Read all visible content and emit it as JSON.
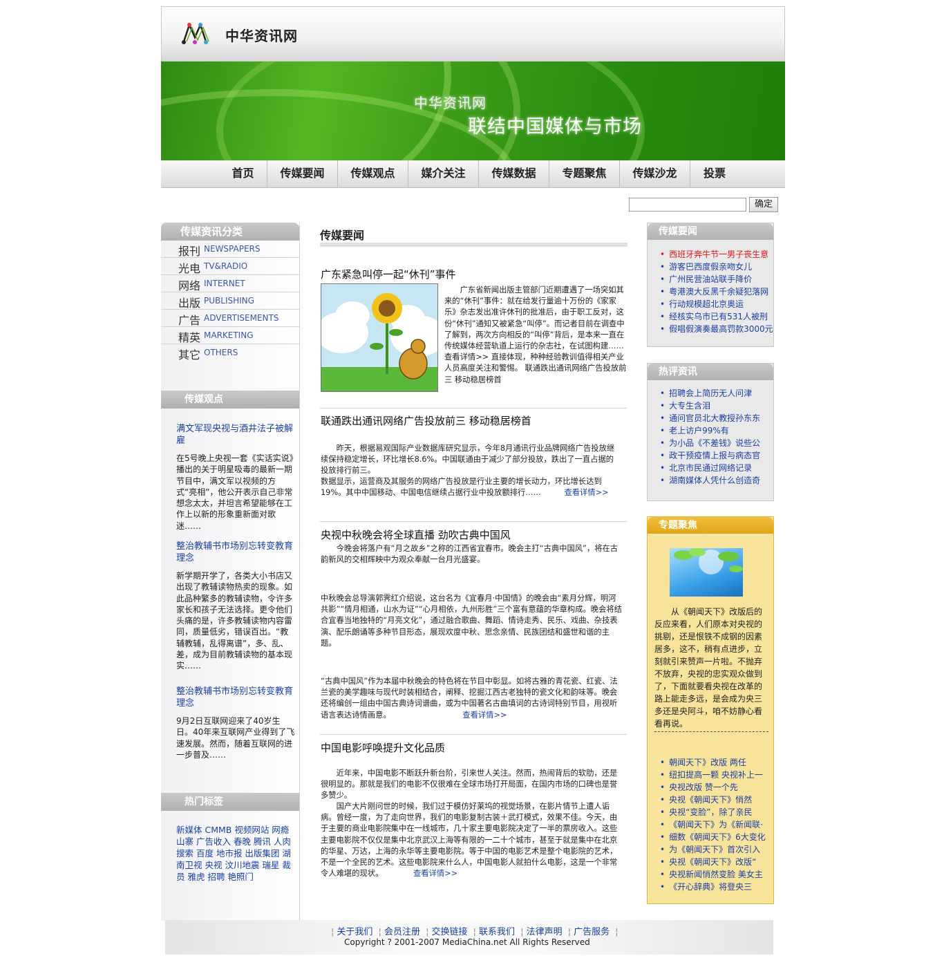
{
  "site": {
    "name": "中华资讯网"
  },
  "banner": {
    "line1": "中华资讯网",
    "line2": "联结中国媒体与市场"
  },
  "nav": [
    "首页",
    "传媒要闻",
    "传媒观点",
    "媒介关注",
    "传媒数据",
    "专题聚焦",
    "传媒沙龙",
    "投票"
  ],
  "search": {
    "button": "确定",
    "value": ""
  },
  "left": {
    "cat_head": "传媒资讯分类",
    "categories": [
      {
        "cn": "报刊",
        "en": "NEWSPAPERS"
      },
      {
        "cn": "光电",
        "en": "TV&RADIO"
      },
      {
        "cn": "网络",
        "en": "INTERNET"
      },
      {
        "cn": "出版",
        "en": "PUBLISHING"
      },
      {
        "cn": "广告",
        "en": "ADVERTISEMENTS"
      },
      {
        "cn": "精英",
        "en": "MARKETING"
      },
      {
        "cn": "其它",
        "en": "OTHERS"
      }
    ],
    "views_head": "传媒观点",
    "views": [
      {
        "title": "满文军现央视与酒井法子被解雇",
        "text": "在5号晚上央视一套《实话实说》播出的关于明星吸毒的最新一期节目中，满文军以视频的方式“亮相”，他公开表示自己非常想念太太，并坦言希望能够在工作上以新的形象重新面对歌迷……"
      },
      {
        "title": "整治教辅书市场别忘转变教育理念",
        "text": "新学期开学了，各类大小书店又出现了教辅读物热卖的现象。如此品种繁多的教辅读物，令许多家长和孩子无法选择。更令他们头痛的是，许多教辅读物内容雷同，质量低劣，错误百出。“教辅教辅，乱得离谱”，多、乱、差，成为目前教辅读物的基本现实……"
      },
      {
        "title": "整治教辅书市场别忘转变教育理念",
        "text": "9月2日互联网迎来了40岁生日。40年来互联网产业得到了飞速发展。然而，随着互联网的进一步普及……"
      }
    ],
    "tags_head": "热门标签",
    "tags": "新媒体 CMMB 视频网站 网瘾 山寨 广告收入 春晚 腾讯 人肉搜索 百度 地市报 出版集团 湖南卫视 央视 汶川地震 瑞星 裁员 雅虎 招聘 艳照门"
  },
  "center": {
    "head": "传媒要闻",
    "articles": [
      {
        "title": "广东紧急叫停一起“休刊”事件",
        "text": "　　广东省新闻出版主管部门近期遭遇了一场突如其来的“休刊”事件：就在给发行量逾十万份的《家家乐》杂志发出准许休刊的批准后，由于职工反对，这份“休刊”通知又被紧急“叫停”。而记者目前在调查中了解到，两次方向相反的“叫停”背后，是本来一直在传统媒体经营轨道上运行的杂志社，在试图构建…… 查看详情>> 直接体现，种种经验教训值得相关产业人员高度关注和警惕。 联通跌出通讯网络广告投放前三 移动稳居榜首"
      },
      {
        "title": "联通跌出通讯网络广告投放前三 移动稳居榜首",
        "text": "　　昨天，根据易观国际产业数据库研究显示，今年8月通讯行业品牌网络广告投放继续保持稳定增长，环比增长8.6%。中国联通由于减少了部分投放，跌出了一直占据的投放排行前三。",
        "text2": "数据显示，运营商及其服务的网络广告投放是行业主要的增长动力，环比增长达到19%。其中中国移动、中国电信继续占据行业中投放额排行……",
        "more": "查看详情>>"
      },
      {
        "title": "央视中秋晚会将全球直播 劲吹古典中国风",
        "p1": "　　今晚会将落户有“月之故乡”之称的江西省宜春市。晚会主打“古典中国风”，将在古韵新风的交相辉映中为观众奉献一台月光盛宴。",
        "p2": "中秋晚会总导演郭霁红介绍说，这台名为《宜春月·中国情》的晚会由“素月分辉，明河共影”“情月相通，山水为证”“心月相依，九州形胜”三个富有意蕴的华章构成。晚会将结合宜春当地独特的“月亮文化”，通过融合歌曲、舞蹈、情诗走秀、民乐、戏曲、杂技表演、配乐朗诵等多种节目形态，展现欢度中秋、思念亲情、民族团结和盛世和谐的主题。",
        "p3": "“古典中国风”作为本届中秋晚会的特色将在节目中彰显。如将古雅的青花瓷、红瓷、法兰瓷的美学趣味与现代时装相结合，阐释、挖掘江西古老独特的瓷文化和韵味等。晚会还将编创一组由中国古典诗词谱曲，或为中国著名古曲填词的古诗词特别节目，用视听语言表达诗情画意。",
        "more": "查看详情>>"
      },
      {
        "title": "中国电影呼唤提升文化品质",
        "p1": "　　近年来，中国电影不断跃升新台阶，引来世人关注。然而，热闹背后的软肋，还是很明显的。那就是我们的电影不仅很难在全球市场打开局面，在国内市场的口碑也是誉多赞少。",
        "p2": "　　国产大片刚问世的时候，我们过于模仿好莱坞的视觉场景，在影片情节上遭人诟病。曾经一度，为了走向世界，我们的电影复制古装＋武打模式，效果不佳。今天，由于主要的商业电影院集中在一线城市，几十家主要电影院决定了一半的票房收入。这些主要电影院不仅仅是集中北京武汉上海等有限的一二十个城市，甚至于就是集中在北京的华星、万达，上海的永华等主要电影院。等于中国的电影艺术是整个电影院的艺术，不是一个全民的艺术。这些电影院来什么人，中国电影人就拍什么电影，这是一个非常令人难堪的现状。",
        "more": "查看详情>>"
      }
    ]
  },
  "right": {
    "news_head": "传媒要闻",
    "news": [
      "西班牙奔牛节一男子丧生意",
      "游客巴西度假亲吻女儿",
      "广州民营油站联手降价",
      "粤港澳大反黑千余疑犯落网",
      "行动规模超北京奥运",
      "经核实乌市已有531人被刑",
      "假唱假演奏最高罚款3000元"
    ],
    "hot_head": "热评资讯",
    "hot": [
      "招聘会上简历无人问津",
      "大专生含泪",
      "通问官员北大教授孙东东",
      "老上访户99%有",
      "为小品《不差钱》说些公",
      "政干预疫情上报与病态官",
      "北京市民通过网络记录",
      "湖南媒体人凭什么创造奇"
    ],
    "special_head": "专题聚焦",
    "special_text": "　　从《朝闻天下》改版后的反应来看，人们原本对央视的挑剔，还是恨铁不成钢的因素居多，这不，稍有点进步，立刻就引来赞声一片啦。不抛弃不放弃，央视的忠实观众做到了，下面就要看央视在改革的路上能走多远，是会成为央三多还是央阿斗，咱不妨静心看看再说。",
    "special_list": [
      "朝闻天下》改版 两任",
      "纽扣提高一颗 央视补上一",
      "央视改版 赞一个先",
      "央视《朝闻天下》悄然",
      "央视“变脸”，除了亲民",
      "《朝闻天下》为《新闻联·",
      "细数《朝闻天下》6大变化",
      "为《朝闻天下》首次引入",
      "央视《朝闻天下》改版“",
      "央视新闻悄然变脸 美女主",
      "《开心辞典》将登央三"
    ]
  },
  "footer": {
    "links": [
      "关于我们",
      "会员注册",
      "交换链接",
      "联系我们",
      "法律声明",
      "广告服务"
    ],
    "copyright": "Copyright ? 2001-2007 MediaChina.net All Rights Reserved"
  },
  "colors": {
    "green": "#3e9d18",
    "link": "#1a3fa8",
    "hot": "#e0141c",
    "yellow": "#f8e39a"
  }
}
